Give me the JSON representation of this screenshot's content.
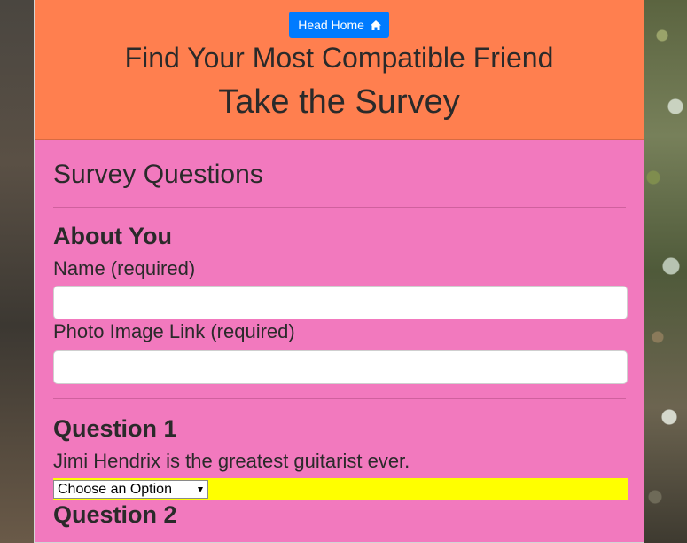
{
  "header": {
    "home_button_label": "Head Home",
    "title": "Find Your Most Compatible Friend",
    "subtitle": "Take the Survey"
  },
  "survey": {
    "heading": "Survey Questions",
    "about_heading": "About You",
    "name_label": "Name (required)",
    "name_value": "",
    "photo_label": "Photo Image Link (required)",
    "photo_value": "",
    "questions": [
      {
        "title": "Question 1",
        "text": "Jimi Hendrix is the greatest guitarist ever.",
        "selected": "Choose an Option"
      },
      {
        "title": "Question 2"
      }
    ]
  },
  "colors": {
    "header_bg": "#ff7f4f",
    "panel_bg": "#f279be",
    "button_bg": "#007bff",
    "select_highlight": "#ffff00"
  },
  "icons": {
    "home_button": "home-icon"
  }
}
